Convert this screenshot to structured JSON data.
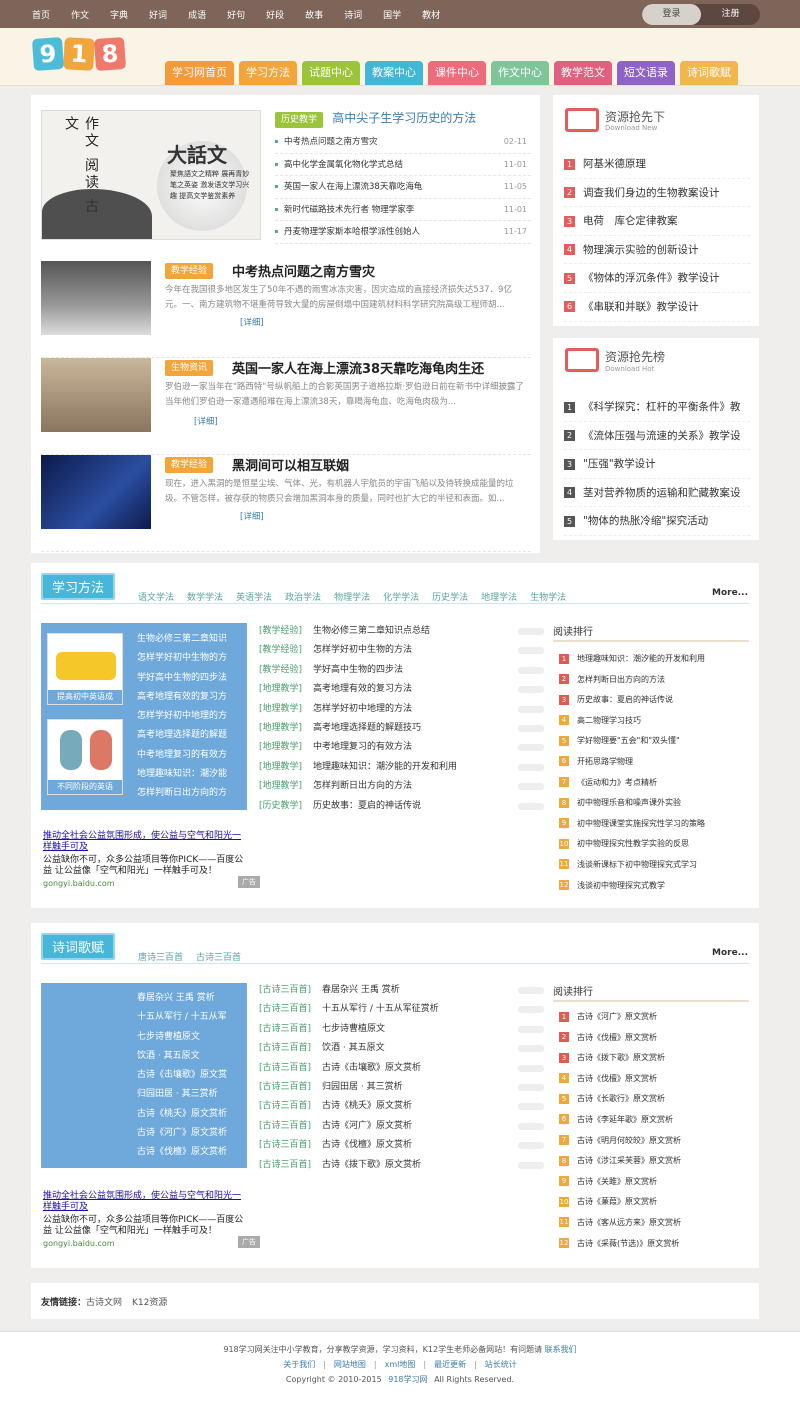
{
  "top_nav": [
    "首页",
    "作文",
    "字典",
    "好词",
    "成语",
    "好句",
    "好段",
    "故事",
    "诗词",
    "国学",
    "教材"
  ],
  "login": "登录",
  "register": "注册",
  "logo": [
    "9",
    "1",
    "8"
  ],
  "logo_colors": [
    "#4cbdd8",
    "#f1a53b",
    "#ef7a6c"
  ],
  "main_nav": [
    {
      "label": "学习网首页",
      "color": "#f49a3a"
    },
    {
      "label": "学习方法",
      "color": "#f1a53b"
    },
    {
      "label": "试题中心",
      "color": "#9cc43a"
    },
    {
      "label": "教案中心",
      "color": "#41b7d8"
    },
    {
      "label": "课件中心",
      "color": "#ee6b7b"
    },
    {
      "label": "作文中心",
      "color": "#7ec59a"
    },
    {
      "label": "教学范文",
      "color": "#e0617f"
    },
    {
      "label": "短文语录",
      "color": "#8f62c6"
    },
    {
      "label": "诗词歌赋",
      "color": "#f0b74e"
    }
  ],
  "featured": {
    "tag": "历史教学",
    "title": "高中尖子生学习历史的方法",
    "banner_big": "大話文",
    "banner_text": "聚焦語文之精粹 展再青妙笔之英姿 激发语文学习兴趣 提高文学鉴赏素养",
    "banner_side": "作文 阅读 古文",
    "items": [
      {
        "t": "中考热点问题之南方雪灾",
        "d": "02-11"
      },
      {
        "t": "高中化学金属氧化物化学式总结",
        "d": "11-01"
      },
      {
        "t": "英国一家人在海上漂流38天靠吃海龟",
        "d": "11-05"
      },
      {
        "t": "新时代磁路技术先行者 物理学家李",
        "d": "11-01"
      },
      {
        "t": "丹麦物理学家斯本哈根学派性创始人",
        "d": "11-17"
      }
    ]
  },
  "articles": [
    {
      "tag": "教学经验",
      "tag_color": "#f1a53b",
      "title": "中考热点问题之南方雪灾",
      "desc": "今年在我国很多地区发生了50年不遇的雨雪冰冻灾害，因灾造成的直接经济损失达537．9亿元。一、南方建筑物不堪重荷导致大量的房屋倒塌中国建筑材料科学研究院高级工程师胡...",
      "more": "[详细]"
    },
    {
      "tag": "生物资讯",
      "tag_color": "#f1a53b",
      "title": "英国一家人在海上漂流38天靠吃海龟肉生还",
      "desc": "罗伯逊一家当年在\"路西特\"号纵帆船上的合影英国男子道格拉斯·罗伯逊日前在新书中详细披露了当年他们罗伯逊一家遭遇船难在海上漂流38天，靠喝海龟血、吃海龟肉极为...",
      "more": "[详细]"
    },
    {
      "tag": "教学经验",
      "tag_color": "#f1a53b",
      "title": "黑洞间可以相互联姻",
      "desc": "现在，进入黑洞的是恒星尘埃、气体、光，有机器人宇航员的宇宙飞船以及待转换成能量的垃圾。不管怎样，被存获的物质只会增加黑洞本身的质量，同时也扩大它的半径和表面。如...",
      "more": "[详细]"
    }
  ],
  "res_new": {
    "title": "资源抢先下",
    "sub": "Download New",
    "items": [
      "阿基米德原理",
      "调查我们身边的生物教案设计",
      "电荷　库仑定律教案",
      "物理演示实验的创新设计",
      "《物体的浮沉条件》教学设计",
      "《串联和并联》教学设计"
    ]
  },
  "res_hot": {
    "title": "资源抢先榜",
    "sub": "Download Hot",
    "items": [
      "《科学探究：杠杆的平衡条件》教",
      "《流体压强与流速的关系》教学设",
      "\"压强\"教学设计",
      "茎对营养物质的运输和贮藏教案设",
      "\"物体的热胀冷缩\"探究活动"
    ]
  },
  "study": {
    "title": "学习方法",
    "more": "More...",
    "subnav": [
      "语文学法",
      "数学学法",
      "英语学法",
      "政治学法",
      "物理学法",
      "化学学法",
      "历史学法",
      "地理学法",
      "生物学法"
    ],
    "img1": "提高初中英语成",
    "img2": "不同阶段的英语",
    "blue_list": [
      "生物必修三第二章知识",
      "怎样学好初中生物的方",
      "学好高中生物的四步法",
      "高考地理有效的复习方",
      "怎样学好初中地理的方",
      "高考地理选择题的解题",
      "中考地理复习的有效方",
      "地理趣味知识：潮汐能",
      "怎样判断日出方向的方"
    ],
    "list": [
      {
        "c": "[教学经验]",
        "t": "生物必修三第二章知识点总结"
      },
      {
        "c": "[教学经验]",
        "t": "怎样学好初中生物的方法"
      },
      {
        "c": "[教学经验]",
        "t": "学好高中生物的四步法"
      },
      {
        "c": "[地理教学]",
        "t": "高考地理有效的复习方法"
      },
      {
        "c": "[地理教学]",
        "t": "怎样学好初中地理的方法"
      },
      {
        "c": "[地理教学]",
        "t": "高考地理选择题的解题技巧"
      },
      {
        "c": "[地理教学]",
        "t": "中考地理复习的有效方法"
      },
      {
        "c": "[地理教学]",
        "t": "地理趣味知识：潮汐能的开发和利用"
      },
      {
        "c": "[地理教学]",
        "t": "怎样判断日出方向的方法"
      },
      {
        "c": "[历史教学]",
        "t": "历史故事：夏启的神话传说"
      }
    ],
    "read_title": "阅读排行",
    "read": [
      "地理趣味知识：潮汐能的开发和利用",
      "怎样判断日出方向的方法",
      "历史故事：夏启的神话传说",
      "高二物理学习技巧",
      "学好物理要\"五会\"和\"双头懂\"",
      "开拓思路学物理",
      "《运动和力》考点精析",
      "初中物理乐音和噪声课外实验",
      "初中物理课堂实施探究性学习的策略",
      "初中物理探究性教学实验的反思",
      "浅谈新课标下初中物理探究式学习",
      "浅谈初中物理探究式教学"
    ]
  },
  "ad": {
    "title": "推动全社会公益氛围形成，使公益与空气和阳光一样触手可及",
    "body": "公益缺你不可，众多公益项目等你PICK——百度公益 让公益像「空气和阳光」一样触手可及！",
    "url": "gongyi.baidu.com",
    "label": "广告"
  },
  "poem": {
    "title": "诗词歌赋",
    "more": "More...",
    "subnav": [
      "唐诗三百首",
      "古诗三百首"
    ],
    "blue_list": [
      "春居杂兴 王禹 赏析",
      "十五从军行 / 十五从军",
      "七步诗曹植原文",
      "饮酒 · 其五原文",
      "古诗《击壤歌》原文赏",
      "归园田居 · 其三赏析",
      "古诗《桃夭》原文赏析",
      "古诗《河广》原文赏析",
      "古诗《伐檀》原文赏析"
    ],
    "list": [
      {
        "c": "[古诗三百首]",
        "t": "春居杂兴 王禹 赏析"
      },
      {
        "c": "[古诗三百首]",
        "t": "十五从军行 / 十五从军征赏析"
      },
      {
        "c": "[古诗三百首]",
        "t": "七步诗曹植原文"
      },
      {
        "c": "[古诗三百首]",
        "t": "饮酒 · 其五原文"
      },
      {
        "c": "[古诗三百首]",
        "t": "古诗《击壤歌》原文赏析"
      },
      {
        "c": "[古诗三百首]",
        "t": "归园田居 · 其三赏析"
      },
      {
        "c": "[古诗三百首]",
        "t": "古诗《桃夭》原文赏析"
      },
      {
        "c": "[古诗三百首]",
        "t": "古诗《河广》原文赏析"
      },
      {
        "c": "[古诗三百首]",
        "t": "古诗《伐檀》原文赏析"
      },
      {
        "c": "[古诗三百首]",
        "t": "古诗《拨下歌》原文赏析"
      }
    ],
    "read_title": "阅读排行",
    "read": [
      "古诗《河广》原文赏析",
      "古诗《伐檀》原文赏析",
      "古诗《拨下歌》原文赏析",
      "古诗《伐檀》原文赏析",
      "古诗《长歌行》原文赏析",
      "古诗《李延年歌》原文赏析",
      "古诗《明月何皎皎》原文赏析",
      "古诗《涉江采芙蓉》原文赏析",
      "古诗《关雎》原文赏析",
      "古诗《蒹葭》原文赏析",
      "古诗《客从远方来》原文赏析",
      "古诗《采薇(节选)》原文赏析"
    ]
  },
  "links": {
    "label": "友情链接：",
    "items": [
      "古诗文网",
      "K12资源"
    ]
  },
  "footer": {
    "line1": "918学习网关注中小学教育，分享教学资源，学习资料，K12学生老师必备网站！有问题请",
    "contact": "联系我们",
    "nav": [
      "关于我们",
      "网站地图",
      "xml地图",
      "最近更新",
      "站长统计"
    ],
    "copy": "Copyright © 2010-2015",
    "brand": "918学习网",
    "rights": "All Rights Reserved."
  },
  "rank_colors": [
    "#e25b50",
    "#e25b50",
    "#e25b50",
    "#f0a83a",
    "#f0a83a",
    "#f0a83a",
    "#f0a83a",
    "#f0a83a",
    "#f0a83a",
    "#f0a83a",
    "#f0a83a",
    "#f0a83a"
  ]
}
